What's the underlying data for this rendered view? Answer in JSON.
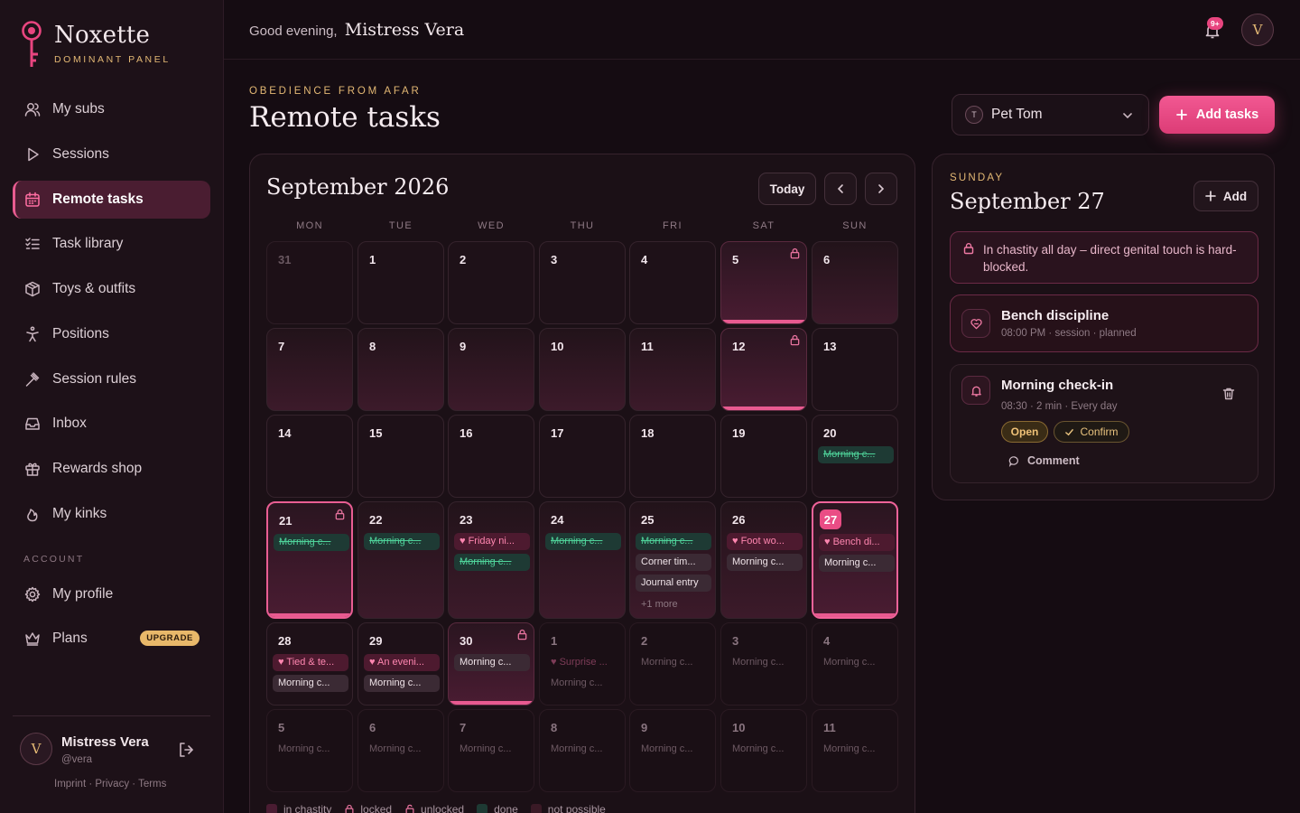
{
  "brand": {
    "name": "Noxette",
    "subtitle": "DOMINANT PANEL"
  },
  "nav": {
    "items": [
      {
        "label": "My subs",
        "icon": "users-icon"
      },
      {
        "label": "Sessions",
        "icon": "play-icon"
      },
      {
        "label": "Remote tasks",
        "icon": "calendar-icon",
        "active": true
      },
      {
        "label": "Task library",
        "icon": "list-check-icon"
      },
      {
        "label": "Toys & outfits",
        "icon": "box-icon"
      },
      {
        "label": "Positions",
        "icon": "figure-icon"
      },
      {
        "label": "Session rules",
        "icon": "gavel-icon"
      },
      {
        "label": "Inbox",
        "icon": "inbox-icon"
      },
      {
        "label": "Rewards shop",
        "icon": "gift-icon"
      },
      {
        "label": "My kinks",
        "icon": "flame-icon"
      }
    ],
    "account_label": "ACCOUNT",
    "account_items": [
      {
        "label": "My profile",
        "icon": "gear-icon"
      },
      {
        "label": "Plans",
        "icon": "crown-icon",
        "badge": "UPGRADE"
      }
    ]
  },
  "user": {
    "initial": "V",
    "name": "Mistress Vera",
    "handle": "@vera"
  },
  "footer": {
    "links": "Imprint · Privacy · Terms"
  },
  "topbar": {
    "greeting": "Good evening,",
    "name": "Mistress Vera",
    "notifications": "9+",
    "avatar_initial": "V"
  },
  "header": {
    "eyebrow": "OBEDIENCE FROM AFAR",
    "title": "Remote tasks"
  },
  "sub_select": {
    "initial": "T",
    "value": "Pet Tom"
  },
  "add_tasks_label": "Add tasks",
  "calendar": {
    "month": "September 2026",
    "today_label": "Today",
    "weekdays": [
      "MON",
      "TUE",
      "WED",
      "THU",
      "FRI",
      "SAT",
      "SUN"
    ],
    "weeks": [
      [
        {
          "d": "31",
          "prev": true
        },
        {
          "d": "1"
        },
        {
          "d": "2"
        },
        {
          "d": "3"
        },
        {
          "d": "4"
        },
        {
          "d": "5",
          "state": "chastity",
          "lock": true
        },
        {
          "d": "6",
          "tint": true
        }
      ],
      [
        {
          "d": "7",
          "tint": true
        },
        {
          "d": "8",
          "tint": true
        },
        {
          "d": "9",
          "tint": true
        },
        {
          "d": "10",
          "tint": true
        },
        {
          "d": "11",
          "tint": true
        },
        {
          "d": "12",
          "state": "chastity",
          "lock": true
        },
        {
          "d": "13"
        }
      ],
      [
        {
          "d": "14"
        },
        {
          "d": "15"
        },
        {
          "d": "16"
        },
        {
          "d": "17"
        },
        {
          "d": "18"
        },
        {
          "d": "19"
        },
        {
          "d": "20",
          "chips": [
            {
              "t": "Morning c...",
              "k": "done"
            }
          ]
        }
      ],
      [
        {
          "d": "21",
          "state": "chastity-sel",
          "lock": true,
          "chips": [
            {
              "t": "Morning c...",
              "k": "done"
            }
          ]
        },
        {
          "d": "22",
          "tint": true,
          "chips": [
            {
              "t": "Morning c...",
              "k": "done"
            }
          ]
        },
        {
          "d": "23",
          "tint": true,
          "chips": [
            {
              "t": "♥ Friday ni...",
              "k": "session"
            },
            {
              "t": "Morning c...",
              "k": "done"
            }
          ]
        },
        {
          "d": "24",
          "tint": true,
          "chips": [
            {
              "t": "Morning c...",
              "k": "done"
            }
          ]
        },
        {
          "d": "25",
          "tint": true,
          "chips": [
            {
              "t": "Morning c...",
              "k": "done"
            },
            {
              "t": "Corner tim...",
              "k": "plain"
            },
            {
              "t": "Journal entry",
              "k": "plain"
            }
          ],
          "more": "+1 more"
        },
        {
          "d": "26",
          "tint": true,
          "chips": [
            {
              "t": "♥ Foot wo...",
              "k": "session"
            },
            {
              "t": "Morning c...",
              "k": "plain"
            }
          ]
        },
        {
          "d": "27",
          "state": "today",
          "chips": [
            {
              "t": "♥ Bench di...",
              "k": "session"
            },
            {
              "t": "Morning c...",
              "k": "plain"
            }
          ]
        }
      ],
      [
        {
          "d": "28",
          "chips": [
            {
              "t": "♥ Tied & te...",
              "k": "session"
            },
            {
              "t": "Morning c...",
              "k": "plain"
            }
          ]
        },
        {
          "d": "29",
          "chips": [
            {
              "t": "♥ An eveni...",
              "k": "session"
            },
            {
              "t": "Morning c...",
              "k": "plain"
            }
          ]
        },
        {
          "d": "30",
          "state": "chastity",
          "lock": true,
          "chips": [
            {
              "t": "Morning c...",
              "k": "plain"
            }
          ]
        },
        {
          "d": "1",
          "out": true,
          "chips": [
            {
              "t": "♥ Surprise ...",
              "k": "session"
            },
            {
              "t": "Morning c...",
              "k": "plain"
            }
          ]
        },
        {
          "d": "2",
          "out": true,
          "chips": [
            {
              "t": "Morning c...",
              "k": "plain"
            }
          ]
        },
        {
          "d": "3",
          "out": true,
          "chips": [
            {
              "t": "Morning c...",
              "k": "plain"
            }
          ]
        },
        {
          "d": "4",
          "out": true,
          "chips": [
            {
              "t": "Morning c...",
              "k": "plain"
            }
          ]
        }
      ],
      [
        {
          "d": "5",
          "out": true,
          "chips": [
            {
              "t": "Morning c...",
              "k": "plain"
            }
          ]
        },
        {
          "d": "6",
          "out": true,
          "chips": [
            {
              "t": "Morning c...",
              "k": "plain"
            }
          ]
        },
        {
          "d": "7",
          "out": true,
          "chips": [
            {
              "t": "Morning c...",
              "k": "plain"
            }
          ]
        },
        {
          "d": "8",
          "out": true,
          "chips": [
            {
              "t": "Morning c...",
              "k": "plain"
            }
          ]
        },
        {
          "d": "9",
          "out": true,
          "chips": [
            {
              "t": "Morning c...",
              "k": "plain"
            }
          ]
        },
        {
          "d": "10",
          "out": true,
          "chips": [
            {
              "t": "Morning c...",
              "k": "plain"
            }
          ]
        },
        {
          "d": "11",
          "out": true,
          "chips": [
            {
              "t": "Morning c...",
              "k": "plain"
            }
          ]
        }
      ]
    ],
    "legend": [
      {
        "label": "in chastity",
        "color": "#4a1c32"
      },
      {
        "label": "locked",
        "icon": "lock-icon"
      },
      {
        "label": "unlocked",
        "icon": "unlock-icon"
      },
      {
        "label": "done",
        "color": "#1e3a34"
      },
      {
        "label": "not possible",
        "color": "#3a1a26"
      }
    ]
  },
  "day_panel": {
    "weekday": "SUNDAY",
    "date": "September 27",
    "add_label": "Add",
    "notice": "In chastity all day – direct genital touch is hard-blocked.",
    "tasks": [
      {
        "title": "Bench discipline",
        "meta": "08:00 PM · session · planned",
        "icon": "heart-icon"
      },
      {
        "title": "Morning check-in",
        "meta": "08:30 · 2 min · Every day",
        "icon": "bell-icon",
        "status": "Open",
        "confirm": "Confirm",
        "comment": "Comment"
      }
    ]
  }
}
